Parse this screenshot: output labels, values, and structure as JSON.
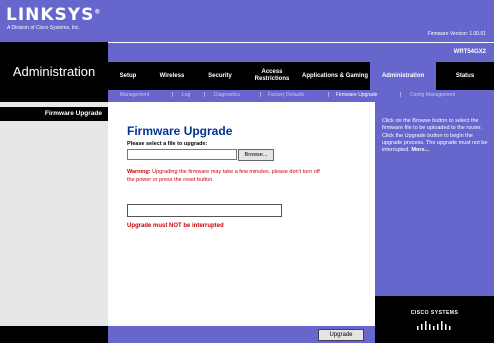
{
  "header": {
    "logo_text": "LINKSYS",
    "logo_registered": "®",
    "logo_subtitle": "A Division of Cisco Systems, Inc.",
    "firmware_version": "Firmware Version: 1.00.01",
    "model": "WRT54GX2",
    "page_heading": "Administration"
  },
  "tabs": [
    {
      "label": "Setup"
    },
    {
      "label": "Wireless"
    },
    {
      "label": "Security"
    },
    {
      "label": "Access Restrictions"
    },
    {
      "label": "Applications & Gaming"
    },
    {
      "label": "Administration"
    },
    {
      "label": "Status"
    }
  ],
  "active_tab": "Administration",
  "subtabs": [
    {
      "label": "Management"
    },
    {
      "label": "Log"
    },
    {
      "label": "Diagnostics"
    },
    {
      "label": "Factory Defaults"
    },
    {
      "label": "Firmware Upgrade"
    },
    {
      "label": "Config Management"
    }
  ],
  "active_subtab": "Firmware Upgrade",
  "sidebar": {
    "section_label": "Firmware Upgrade"
  },
  "main": {
    "title": "Firmware Upgrade",
    "select_label": "Please select a file to upgrade:",
    "file_value": "",
    "browse_label": "Browse...",
    "warning_label": "Warning:",
    "warning_text": "Upgrading the firmware may take a few minutes, please don't turn off the power or press the reset button.",
    "progress": 0,
    "interrupt_note": "Upgrade must NOT be interrupted"
  },
  "help": {
    "text": "Click on the Browse button to select the firmware file to be uploaded to the router. Click the Upgrade button to begin the upgrade process. The upgrade must not be interrupted.",
    "more": "More..."
  },
  "footer": {
    "upgrade_label": "Upgrade",
    "brand": "CISCO SYSTEMS"
  },
  "colors": {
    "brand_purple": "#6666cc",
    "black": "#000000",
    "title_blue": "#003399",
    "warning_red": "#cc0000"
  }
}
